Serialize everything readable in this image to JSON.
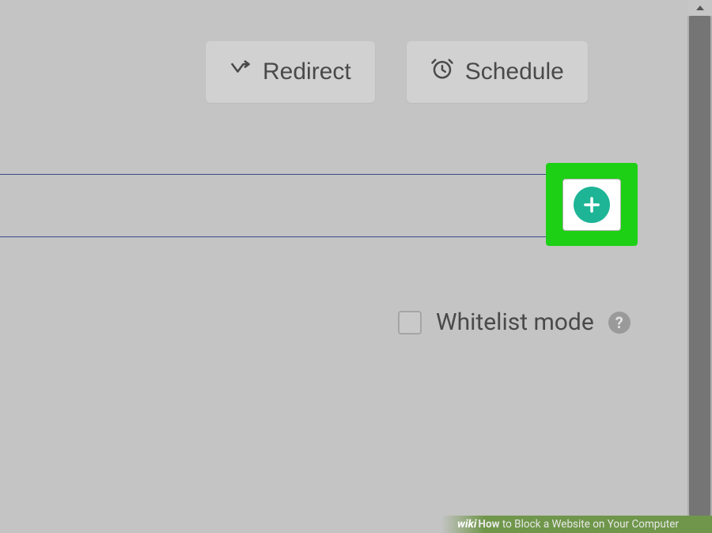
{
  "toolbar": {
    "redirect_label": "Redirect",
    "schedule_label": "Schedule"
  },
  "input": {
    "value": "",
    "placeholder": ""
  },
  "whitelist": {
    "label": "Whitelist mode",
    "checked": false,
    "help_symbol": "?"
  },
  "footer": {
    "brand_prefix": "wiki",
    "title_bold": "How",
    "title_rest": " to Block a Website on Your Computer"
  },
  "colors": {
    "highlight_green": "#1ed015",
    "add_circle": "#1db596",
    "banner_green": "#6f964a"
  }
}
